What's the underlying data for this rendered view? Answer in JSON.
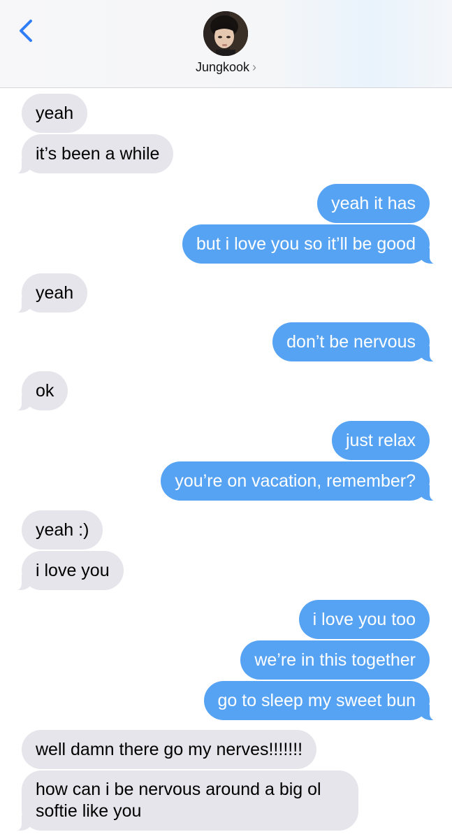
{
  "header": {
    "contact_name": "Jungkook",
    "chevron": "›",
    "back_icon": "chevron-left-icon",
    "accent_color": "#2f7ef6"
  },
  "colors": {
    "incoming_bubble": "#e6e5eb",
    "outgoing_bubble": "#57a3f3",
    "outgoing_text": "#ffffff",
    "incoming_text": "#000000"
  },
  "messages": [
    {
      "direction": "incoming",
      "text": "yeah"
    },
    {
      "direction": "incoming",
      "text": "it’s been a while"
    },
    {
      "direction": "outgoing",
      "text": "yeah it has"
    },
    {
      "direction": "outgoing",
      "text": "but i love you so it’ll be good"
    },
    {
      "direction": "incoming",
      "text": "yeah"
    },
    {
      "direction": "outgoing",
      "text": "don’t be nervous"
    },
    {
      "direction": "incoming",
      "text": "ok"
    },
    {
      "direction": "outgoing",
      "text": "just relax"
    },
    {
      "direction": "outgoing",
      "text": "you’re on vacation, remember?"
    },
    {
      "direction": "incoming",
      "text": "yeah :)"
    },
    {
      "direction": "incoming",
      "text": "i love you"
    },
    {
      "direction": "outgoing",
      "text": "i love you too"
    },
    {
      "direction": "outgoing",
      "text": "we’re in this together"
    },
    {
      "direction": "outgoing",
      "text": "go to sleep my sweet bun"
    },
    {
      "direction": "incoming",
      "text": "well damn there go my nerves!!!!!!!"
    },
    {
      "direction": "incoming",
      "text": "how can i be nervous around a big ol softie like you"
    }
  ]
}
